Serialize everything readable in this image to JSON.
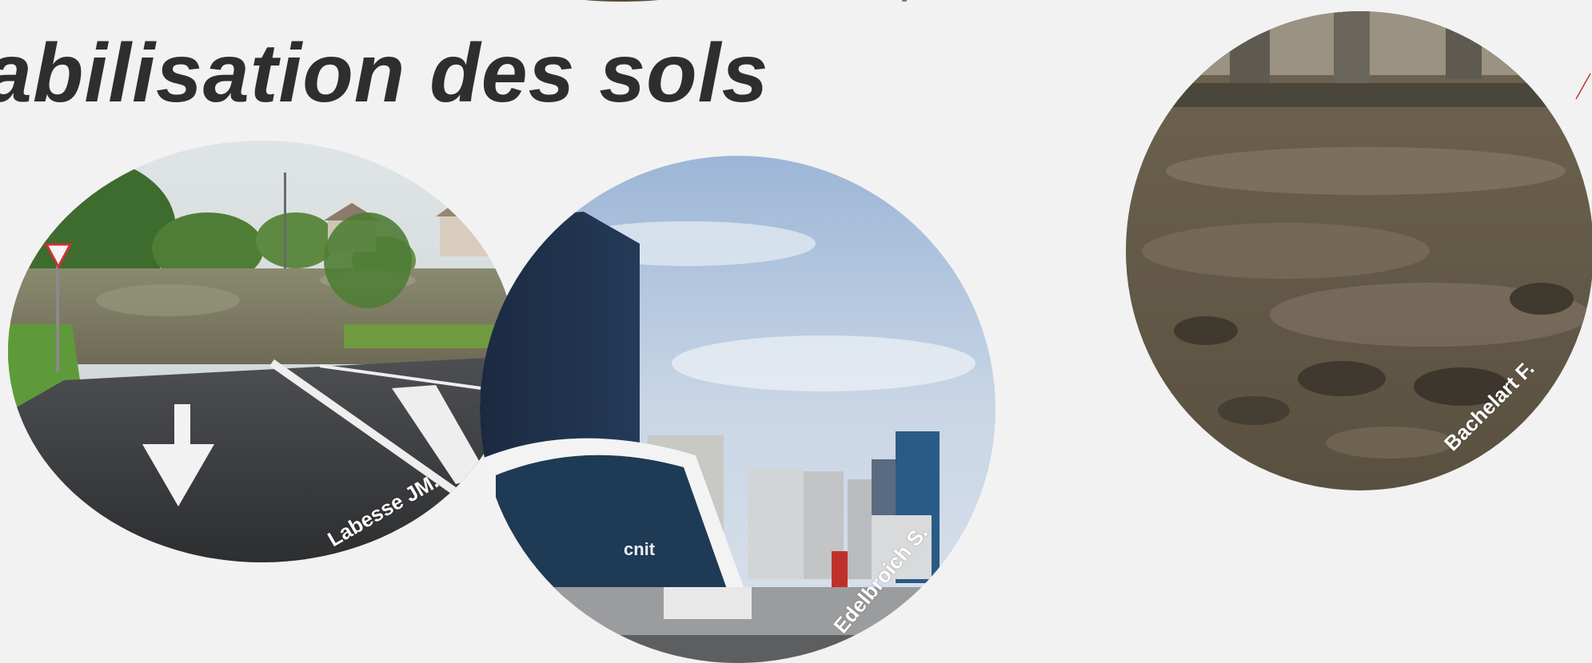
{
  "slide": {
    "title": "abilisation des sols"
  },
  "photos": {
    "flooded_road": {
      "credit": "Labesse JM."
    },
    "la_defense": {
      "credit": "Edelbroich S.",
      "sign_text": "cnit"
    },
    "muddy_ground": {
      "credit": "Bachelart F."
    }
  },
  "colors": {
    "background": "#f2f2f2",
    "title": "#2e2e2e",
    "accent_line": "#c0392b"
  }
}
